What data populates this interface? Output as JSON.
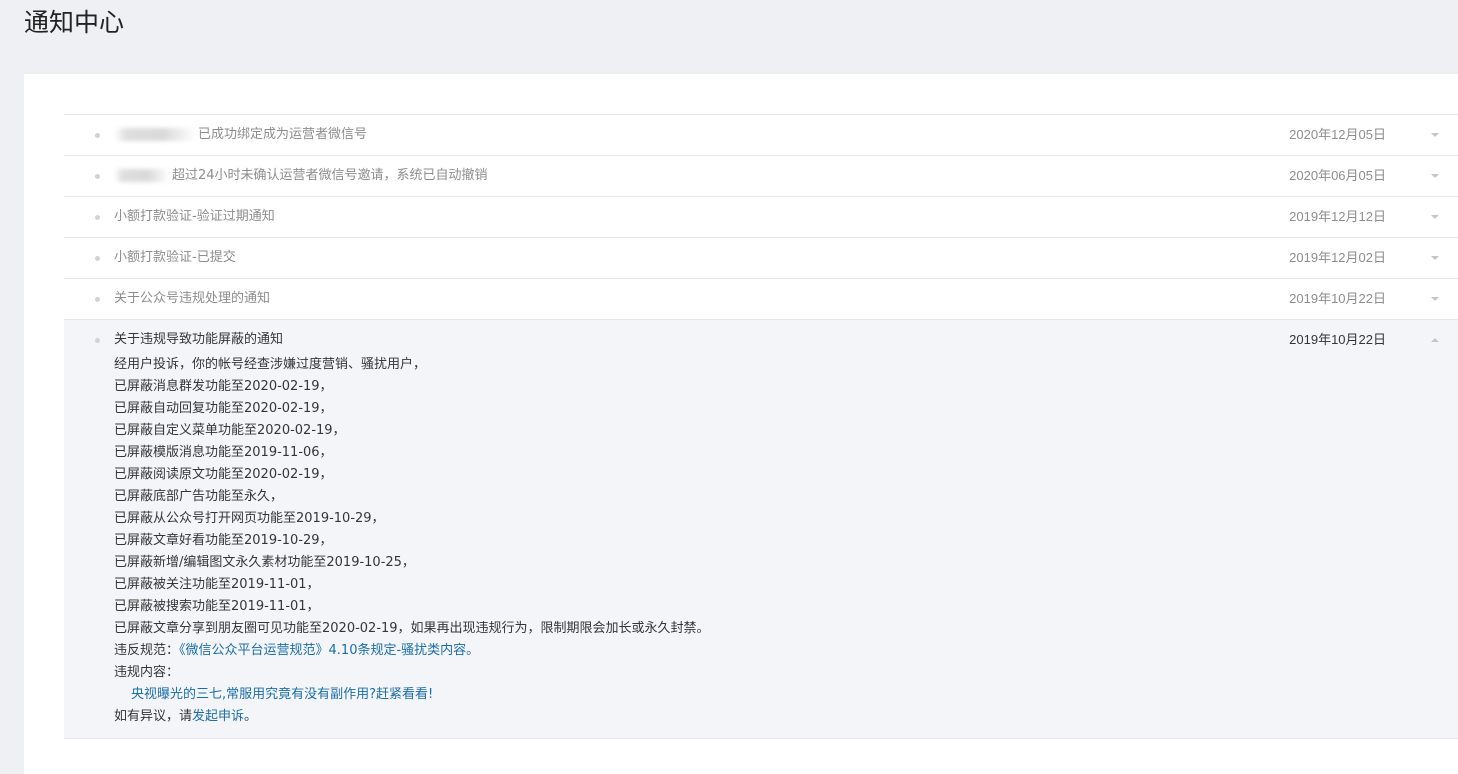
{
  "page": {
    "title": "通知中心"
  },
  "notices": [
    {
      "title": "已成功绑定成为运营者微信号",
      "date": "2020年12月05日",
      "redacted": true
    },
    {
      "title": "超过24小时未确认运营者微信号邀请，系统已自动撤销",
      "date": "2020年06月05日",
      "redacted": true
    },
    {
      "title": "小额打款验证-验证过期通知",
      "date": "2019年12月12日"
    },
    {
      "title": "小额打款验证-已提交",
      "date": "2019年12月02日"
    },
    {
      "title": "关于公众号违规处理的通知",
      "date": "2019年10月22日"
    }
  ],
  "expanded_notice": {
    "title": "关于违规导致功能屏蔽的通知",
    "date": "2019年10月22日",
    "lines": [
      "经用户投诉，你的帐号经查涉嫌过度营销、骚扰用户，",
      "已屏蔽消息群发功能至2020-02-19，",
      "已屏蔽自动回复功能至2020-02-19，",
      "已屏蔽自定义菜单功能至2020-02-19，",
      "已屏蔽模版消息功能至2019-11-06，",
      "已屏蔽阅读原文功能至2020-02-19，",
      "已屏蔽底部广告功能至永久，",
      "已屏蔽从公众号打开网页功能至2019-10-29，",
      "已屏蔽文章好看功能至2019-10-29，",
      "已屏蔽新增/编辑图文永久素材功能至2019-10-25，",
      "已屏蔽被关注功能至2019-11-01，",
      "已屏蔽被搜索功能至2019-11-01，",
      "已屏蔽文章分享到朋友圈可见功能至2020-02-19，如果再出现违规行为，限制期限会加长或永久封禁。"
    ],
    "rule_prefix": "违反规范：",
    "rule_link": "《微信公众平台运营规范》4.10条规定-骚扰类内容。",
    "content_label": "违规内容：",
    "content_link": "央视曝光的三七,常服用究竟有没有副作用?赶紧看看!",
    "appeal_prefix": "如有异议，请",
    "appeal_link": "发起申诉",
    "appeal_suffix": "。"
  }
}
